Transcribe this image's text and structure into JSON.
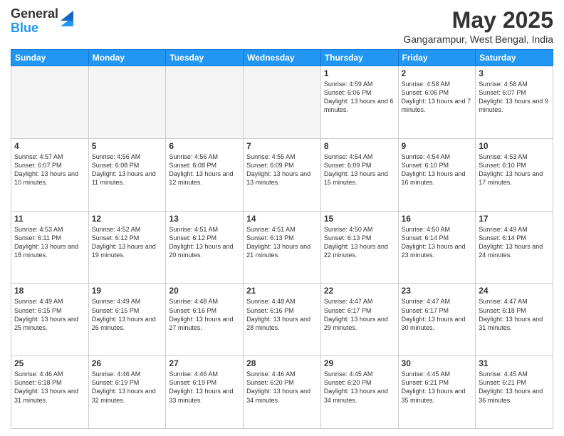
{
  "logo": {
    "general": "General",
    "blue": "Blue"
  },
  "title": "May 2025",
  "subtitle": "Gangarampur, West Bengal, India",
  "days_of_week": [
    "Sunday",
    "Monday",
    "Tuesday",
    "Wednesday",
    "Thursday",
    "Friday",
    "Saturday"
  ],
  "weeks": [
    [
      {
        "day": "",
        "info": ""
      },
      {
        "day": "",
        "info": ""
      },
      {
        "day": "",
        "info": ""
      },
      {
        "day": "",
        "info": ""
      },
      {
        "day": "1",
        "info": "Sunrise: 4:59 AM\nSunset: 6:06 PM\nDaylight: 13 hours and 6 minutes."
      },
      {
        "day": "2",
        "info": "Sunrise: 4:58 AM\nSunset: 6:06 PM\nDaylight: 13 hours and 7 minutes."
      },
      {
        "day": "3",
        "info": "Sunrise: 4:58 AM\nSunset: 6:07 PM\nDaylight: 13 hours and 9 minutes."
      }
    ],
    [
      {
        "day": "4",
        "info": "Sunrise: 4:57 AM\nSunset: 6:07 PM\nDaylight: 13 hours and 10 minutes."
      },
      {
        "day": "5",
        "info": "Sunrise: 4:56 AM\nSunset: 6:08 PM\nDaylight: 13 hours and 11 minutes."
      },
      {
        "day": "6",
        "info": "Sunrise: 4:56 AM\nSunset: 6:08 PM\nDaylight: 13 hours and 12 minutes."
      },
      {
        "day": "7",
        "info": "Sunrise: 4:55 AM\nSunset: 6:09 PM\nDaylight: 13 hours and 13 minutes."
      },
      {
        "day": "8",
        "info": "Sunrise: 4:54 AM\nSunset: 6:09 PM\nDaylight: 13 hours and 15 minutes."
      },
      {
        "day": "9",
        "info": "Sunrise: 4:54 AM\nSunset: 6:10 PM\nDaylight: 13 hours and 16 minutes."
      },
      {
        "day": "10",
        "info": "Sunrise: 4:53 AM\nSunset: 6:10 PM\nDaylight: 13 hours and 17 minutes."
      }
    ],
    [
      {
        "day": "11",
        "info": "Sunrise: 4:53 AM\nSunset: 6:11 PM\nDaylight: 13 hours and 18 minutes."
      },
      {
        "day": "12",
        "info": "Sunrise: 4:52 AM\nSunset: 6:12 PM\nDaylight: 13 hours and 19 minutes."
      },
      {
        "day": "13",
        "info": "Sunrise: 4:51 AM\nSunset: 6:12 PM\nDaylight: 13 hours and 20 minutes."
      },
      {
        "day": "14",
        "info": "Sunrise: 4:51 AM\nSunset: 6:13 PM\nDaylight: 13 hours and 21 minutes."
      },
      {
        "day": "15",
        "info": "Sunrise: 4:50 AM\nSunset: 6:13 PM\nDaylight: 13 hours and 22 minutes."
      },
      {
        "day": "16",
        "info": "Sunrise: 4:50 AM\nSunset: 6:14 PM\nDaylight: 13 hours and 23 minutes."
      },
      {
        "day": "17",
        "info": "Sunrise: 4:49 AM\nSunset: 6:14 PM\nDaylight: 13 hours and 24 minutes."
      }
    ],
    [
      {
        "day": "18",
        "info": "Sunrise: 4:49 AM\nSunset: 6:15 PM\nDaylight: 13 hours and 25 minutes."
      },
      {
        "day": "19",
        "info": "Sunrise: 4:49 AM\nSunset: 6:15 PM\nDaylight: 13 hours and 26 minutes."
      },
      {
        "day": "20",
        "info": "Sunrise: 4:48 AM\nSunset: 6:16 PM\nDaylight: 13 hours and 27 minutes."
      },
      {
        "day": "21",
        "info": "Sunrise: 4:48 AM\nSunset: 6:16 PM\nDaylight: 13 hours and 28 minutes."
      },
      {
        "day": "22",
        "info": "Sunrise: 4:47 AM\nSunset: 6:17 PM\nDaylight: 13 hours and 29 minutes."
      },
      {
        "day": "23",
        "info": "Sunrise: 4:47 AM\nSunset: 6:17 PM\nDaylight: 13 hours and 30 minutes."
      },
      {
        "day": "24",
        "info": "Sunrise: 4:47 AM\nSunset: 6:18 PM\nDaylight: 13 hours and 31 minutes."
      }
    ],
    [
      {
        "day": "25",
        "info": "Sunrise: 4:46 AM\nSunset: 6:18 PM\nDaylight: 13 hours and 31 minutes."
      },
      {
        "day": "26",
        "info": "Sunrise: 4:46 AM\nSunset: 6:19 PM\nDaylight: 13 hours and 32 minutes."
      },
      {
        "day": "27",
        "info": "Sunrise: 4:46 AM\nSunset: 6:19 PM\nDaylight: 13 hours and 33 minutes."
      },
      {
        "day": "28",
        "info": "Sunrise: 4:46 AM\nSunset: 6:20 PM\nDaylight: 13 hours and 34 minutes."
      },
      {
        "day": "29",
        "info": "Sunrise: 4:45 AM\nSunset: 6:20 PM\nDaylight: 13 hours and 34 minutes."
      },
      {
        "day": "30",
        "info": "Sunrise: 4:45 AM\nSunset: 6:21 PM\nDaylight: 13 hours and 35 minutes."
      },
      {
        "day": "31",
        "info": "Sunrise: 4:45 AM\nSunset: 6:21 PM\nDaylight: 13 hours and 36 minutes."
      }
    ]
  ]
}
